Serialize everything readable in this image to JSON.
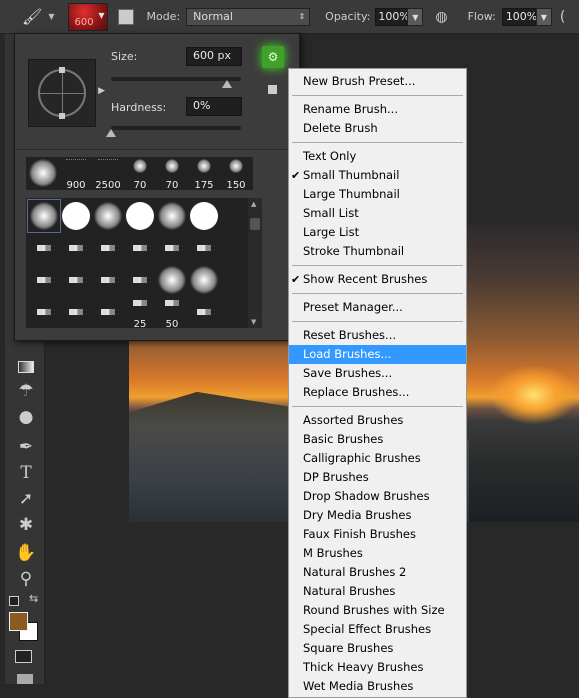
{
  "options_bar": {
    "brush_size": "600",
    "mode_label": "Mode:",
    "mode_value": "Normal",
    "opacity_label": "Opacity:",
    "opacity_value": "100%",
    "flow_label": "Flow:",
    "flow_value": "100%"
  },
  "brush_panel": {
    "size_label": "Size:",
    "size_value": "600 px",
    "size_fraction": 0.95,
    "hardness_label": "Hardness:",
    "hardness_value": "0%",
    "hardness_fraction": 0,
    "recent": [
      {
        "label": "",
        "kind": "soft"
      },
      {
        "label": "900",
        "kind": "spatter"
      },
      {
        "label": "2500",
        "kind": "spatter"
      },
      {
        "label": "70",
        "kind": "soft"
      },
      {
        "label": "70",
        "kind": "soft"
      },
      {
        "label": "175",
        "kind": "soft"
      },
      {
        "label": "150",
        "kind": "soft"
      }
    ],
    "grid": [
      {
        "label": "",
        "kind": "soft"
      },
      {
        "label": "",
        "kind": "hard"
      },
      {
        "label": "",
        "kind": "soft"
      },
      {
        "label": "",
        "kind": "hard"
      },
      {
        "label": "",
        "kind": "soft"
      },
      {
        "label": "",
        "kind": "hard"
      },
      {
        "label": "",
        "kind": "tip"
      },
      {
        "label": "",
        "kind": "tip"
      },
      {
        "label": "",
        "kind": "tip"
      },
      {
        "label": "",
        "kind": "tip"
      },
      {
        "label": "",
        "kind": "tip"
      },
      {
        "label": "",
        "kind": "tip"
      },
      {
        "label": "",
        "kind": "tip"
      },
      {
        "label": "",
        "kind": "tip"
      },
      {
        "label": "",
        "kind": "tip"
      },
      {
        "label": "",
        "kind": "tip"
      },
      {
        "label": "",
        "kind": "soft"
      },
      {
        "label": "",
        "kind": "soft"
      },
      {
        "label": "",
        "kind": "tip"
      },
      {
        "label": "",
        "kind": "tip"
      },
      {
        "label": "",
        "kind": "tip"
      },
      {
        "label": "25",
        "kind": "tip"
      },
      {
        "label": "50",
        "kind": "tip"
      },
      {
        "label": "",
        "kind": "tip"
      }
    ]
  },
  "menu": [
    {
      "label": "New Brush Preset..."
    },
    {
      "sep": true
    },
    {
      "label": "Rename Brush..."
    },
    {
      "label": "Delete Brush"
    },
    {
      "sep": true
    },
    {
      "label": "Text Only"
    },
    {
      "label": "Small Thumbnail",
      "checked": true
    },
    {
      "label": "Large Thumbnail"
    },
    {
      "label": "Small List"
    },
    {
      "label": "Large List"
    },
    {
      "label": "Stroke Thumbnail"
    },
    {
      "sep": true
    },
    {
      "label": "Show Recent Brushes",
      "checked": true
    },
    {
      "sep": true
    },
    {
      "label": "Preset Manager..."
    },
    {
      "sep": true
    },
    {
      "label": "Reset Brushes..."
    },
    {
      "label": "Load Brushes...",
      "highlighted": true
    },
    {
      "label": "Save Brushes..."
    },
    {
      "label": "Replace Brushes..."
    },
    {
      "sep": true
    },
    {
      "label": "Assorted Brushes"
    },
    {
      "label": "Basic Brushes"
    },
    {
      "label": "Calligraphic Brushes"
    },
    {
      "label": "DP Brushes"
    },
    {
      "label": "Drop Shadow Brushes"
    },
    {
      "label": "Dry Media Brushes"
    },
    {
      "label": "Faux Finish Brushes"
    },
    {
      "label": "M Brushes"
    },
    {
      "label": "Natural Brushes 2"
    },
    {
      "label": "Natural Brushes"
    },
    {
      "label": "Round Brushes with Size"
    },
    {
      "label": "Special Effect Brushes"
    },
    {
      "label": "Square Brushes"
    },
    {
      "label": "Thick Heavy Brushes"
    },
    {
      "label": "Wet Media Brushes"
    }
  ],
  "colors": {
    "foreground": "#8a5a22",
    "background": "#ffffff",
    "highlight": "#3399ff",
    "gear_button": "#3fa02a"
  }
}
